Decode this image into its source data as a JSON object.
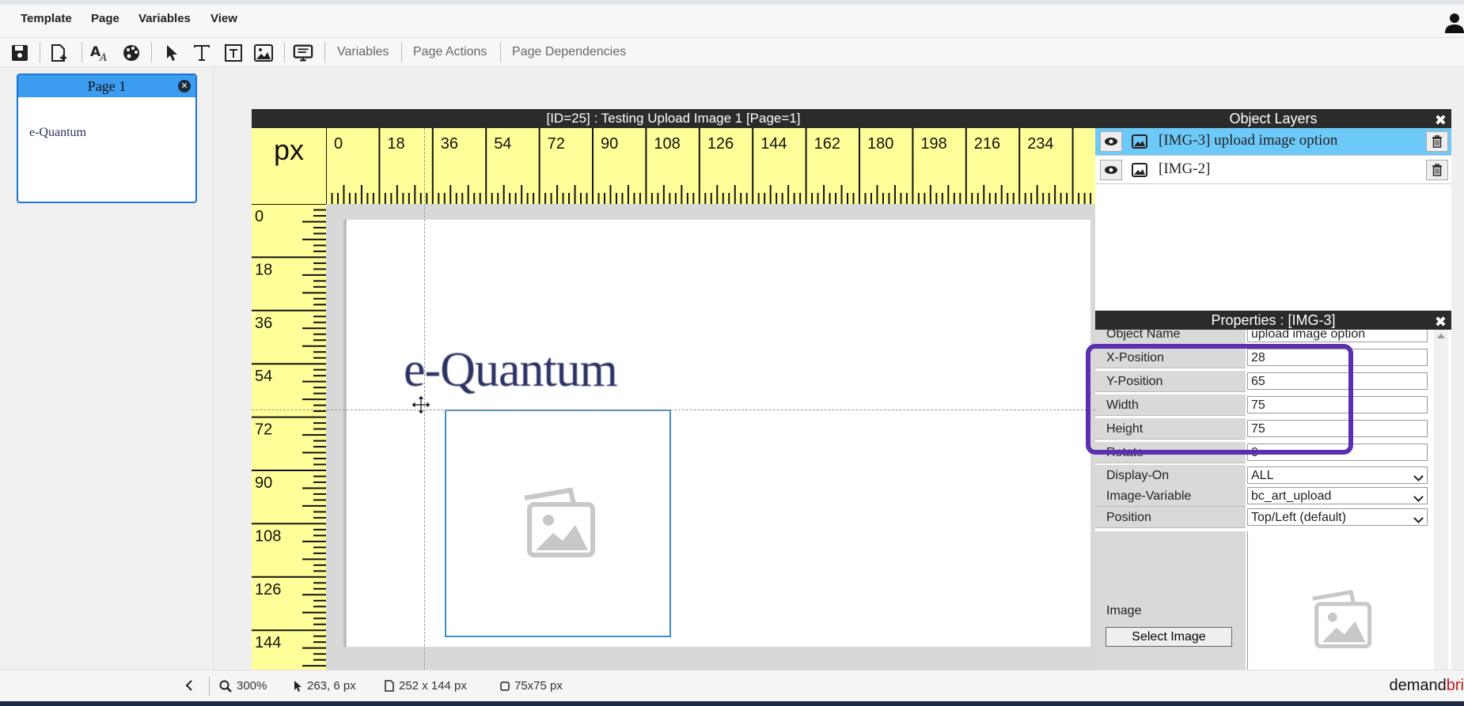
{
  "menu": [
    "Template",
    "Page",
    "Variables",
    "View"
  ],
  "toolbar": {
    "icons": [
      "save-icon",
      "add-page-icon",
      "font-icon",
      "palette-icon",
      "pointer-icon",
      "text-icon",
      "textbox-icon",
      "image-icon",
      "preview-icon"
    ],
    "links": [
      "Variables",
      "Page Actions",
      "Page Dependencies"
    ]
  },
  "pages_panel": {
    "page_title": "Page 1",
    "thumb_logo": "e-Quantum"
  },
  "editor": {
    "title": "[ID=25] : Testing Upload Image 1 [Page=1]",
    "unit": "px",
    "h_ticks": [
      "0",
      "18",
      "36",
      "54",
      "72",
      "90",
      "108",
      "126",
      "144",
      "162",
      "180",
      "198",
      "216",
      "234"
    ],
    "v_ticks": [
      "0",
      "18",
      "36",
      "54",
      "72",
      "90",
      "108",
      "126",
      "144"
    ],
    "logo_text": "e-Quantum"
  },
  "layers": {
    "title": "Object Layers",
    "items": [
      {
        "label": "[IMG-3] upload image option",
        "selected": true
      },
      {
        "label": "[IMG-2]",
        "selected": false
      }
    ]
  },
  "properties": {
    "title": "Properties : [IMG-3]",
    "object_name_label": "Object Name",
    "object_name": "upload image option",
    "x_label": "X-Position",
    "x": "28",
    "y_label": "Y-Position",
    "y": "65",
    "w_label": "Width",
    "w": "75",
    "h_label": "Height",
    "h": "75",
    "rotate_label": "Rotate",
    "rotate": "0",
    "display_label": "Display-On",
    "display": "ALL",
    "imgvar_label": "Image-Variable",
    "imgvar": "bc_art_upload",
    "position_label": "Position",
    "position": "Top/Left (default)",
    "image_label": "Image",
    "select_image": "Select Image"
  },
  "status": {
    "zoom": "300%",
    "cursor": "263, 6 px",
    "page_size": "252 x 144 px",
    "object_size": "75x75 px",
    "brand_a": "demand",
    "brand_b": "bri"
  },
  "colors": {
    "accent": "#3c9cf0",
    "ruler": "#ffff99",
    "highlight": "#5b2fb0",
    "selected_layer": "#6dc9f7"
  }
}
